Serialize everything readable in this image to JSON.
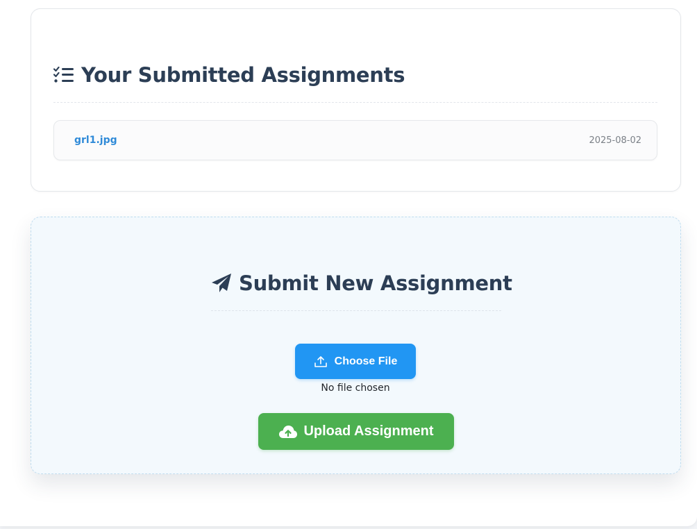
{
  "submitted": {
    "heading": "Your Submitted Assignments",
    "icon": "checklist-icon",
    "items": [
      {
        "file_name": "grl1.jpg",
        "date": "2025-08-02"
      }
    ]
  },
  "submit_form": {
    "heading": "Submit New Assignment",
    "icon": "paper-plane-icon",
    "choose_file_label": "Choose File",
    "choose_file_icon": "upload-icon",
    "file_status": "No file chosen",
    "upload_label": "Upload Assignment",
    "upload_icon": "cloud-upload-icon"
  },
  "colors": {
    "heading": "#2c3e55",
    "link": "#2f8ad8",
    "choose_button": "#2196f3",
    "upload_button": "#4cb050"
  }
}
